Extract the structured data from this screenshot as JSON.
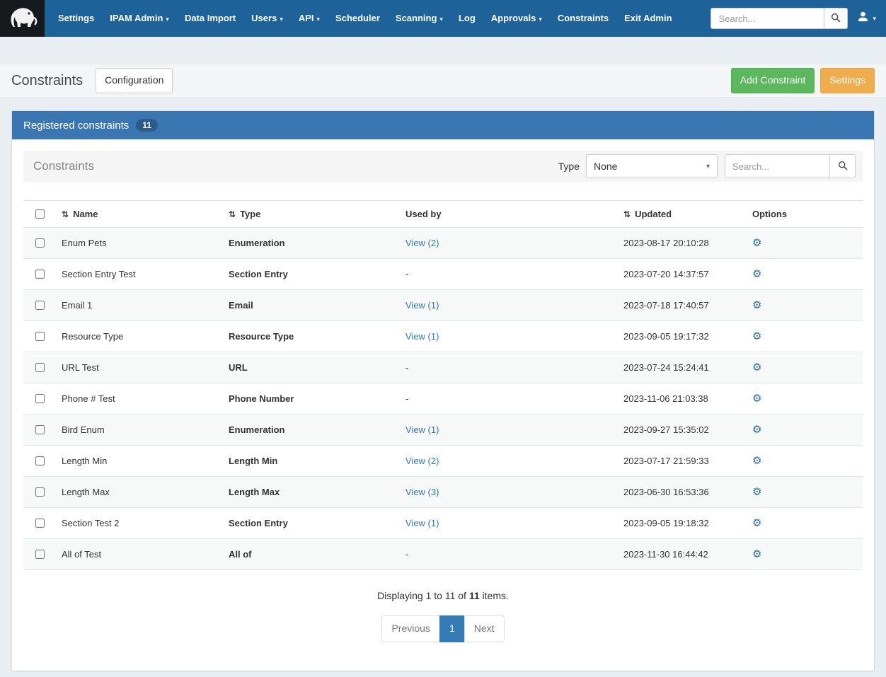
{
  "navbar": {
    "items": [
      {
        "label": "Settings",
        "dropdown": false
      },
      {
        "label": "IPAM Admin",
        "dropdown": true
      },
      {
        "label": "Data Import",
        "dropdown": false
      },
      {
        "label": "Users",
        "dropdown": true
      },
      {
        "label": "API",
        "dropdown": true
      },
      {
        "label": "Scheduler",
        "dropdown": false
      },
      {
        "label": "Scanning",
        "dropdown": true
      },
      {
        "label": "Log",
        "dropdown": false
      },
      {
        "label": "Approvals",
        "dropdown": true
      },
      {
        "label": "Constraints",
        "dropdown": false
      },
      {
        "label": "Exit Admin",
        "dropdown": false
      }
    ],
    "search_placeholder": "Search..."
  },
  "page_header": {
    "title": "Constraints",
    "configuration_button": "Configuration",
    "add_constraint_button": "Add Constraint",
    "settings_button": "Settings"
  },
  "panel": {
    "title": "Registered constraints",
    "badge": "11"
  },
  "toolbar": {
    "title": "Constraints",
    "type_label": "Type",
    "type_value": "None",
    "search_placeholder": "Search..."
  },
  "table": {
    "columns": [
      {
        "label": "Name",
        "sortable": true
      },
      {
        "label": "Type",
        "sortable": true
      },
      {
        "label": "Used by",
        "sortable": false
      },
      {
        "label": "Updated",
        "sortable": true
      },
      {
        "label": "Options",
        "sortable": false
      }
    ],
    "rows": [
      {
        "name": "Enum Pets",
        "type": "Enumeration",
        "used_by": "View (2)",
        "updated": "2023-08-17 20:10:28"
      },
      {
        "name": "Section Entry Test",
        "type": "Section Entry",
        "used_by": "-",
        "updated": "2023-07-20 14:37:57"
      },
      {
        "name": "Email 1",
        "type": "Email",
        "used_by": "View (1)",
        "updated": "2023-07-18 17:40:57"
      },
      {
        "name": "Resource Type",
        "type": "Resource Type",
        "used_by": "View (1)",
        "updated": "2023-09-05 19:17:32"
      },
      {
        "name": "URL Test",
        "type": "URL",
        "used_by": "-",
        "updated": "2023-07-24 15:24:41"
      },
      {
        "name": "Phone # Test",
        "type": "Phone Number",
        "used_by": "-",
        "updated": "2023-11-06 21:03:38"
      },
      {
        "name": "Bird Enum",
        "type": "Enumeration",
        "used_by": "View (1)",
        "updated": "2023-09-27 15:35:02"
      },
      {
        "name": "Length Min",
        "type": "Length Min",
        "used_by": "View (2)",
        "updated": "2023-07-17 21:59:33"
      },
      {
        "name": "Length Max",
        "type": "Length Max",
        "used_by": "View (3)",
        "updated": "2023-06-30 16:53:36"
      },
      {
        "name": "Section Test 2",
        "type": "Section Entry",
        "used_by": "View (1)",
        "updated": "2023-09-05 19:18:32"
      },
      {
        "name": "All of Test",
        "type": "All of",
        "used_by": "-",
        "updated": "2023-11-30 16:44:42"
      }
    ]
  },
  "footer": {
    "display_prefix": "Displaying 1 to 11 of",
    "display_total": "11",
    "display_suffix": "items."
  },
  "pagination": {
    "previous_label": "Previous",
    "current_page": "1",
    "next_label": "Next"
  },
  "icons": {
    "sort": "⇅",
    "gear": "⚙",
    "caret": "▾"
  },
  "colors": {
    "navbar_bg": "#1d6399",
    "panel_header_bg": "#3a76b2",
    "accent": "#337ab7",
    "success": "#5cb85c",
    "warning": "#f0ad4e"
  }
}
